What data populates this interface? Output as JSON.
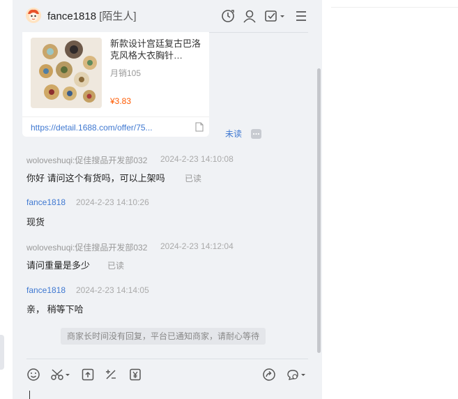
{
  "header": {
    "name": "fance1818",
    "tag": "[陌生人]"
  },
  "product": {
    "name": "新款设计宫廷复古巴洛克风格大衣胸针…",
    "sales": "月销105",
    "price": "¥3.83",
    "link": "https://detail.1688.com/offer/75...",
    "status": "未读"
  },
  "messages": [
    {
      "sender": "woloveshuqi:促佳搜品开发部032",
      "time": "2024-2-23 14:10:08",
      "text": "你好 请问这个有货吗，可以上架吗",
      "status": "已读"
    },
    {
      "sender": "fance1818",
      "time": "2024-2-23 14:10:26",
      "text": "现货",
      "status": ""
    },
    {
      "sender": "woloveshuqi:促佳搜品开发部032",
      "time": "2024-2-23 14:12:04",
      "text": "请问重量是多少",
      "status": "已读"
    },
    {
      "sender": "fance1818",
      "time": "2024-2-23 14:14:05",
      "text": "亲， 稍等下哈",
      "status": ""
    }
  ],
  "notice": "商家长时间没有回复，平台已通知商家，请耐心等待",
  "icons": {
    "header": [
      "history-icon",
      "user-icon",
      "task-check-icon",
      "menu-icon"
    ],
    "toolbar": [
      "emoji-icon",
      "scissors-icon",
      "upload-icon",
      "discount-icon",
      "yuan-receipt-icon",
      "forward-icon",
      "quick-reply-icon"
    ]
  },
  "colors": {
    "link": "#3f78d1",
    "price": "#ff5a00",
    "chat_bg": "#f0f2f5"
  }
}
